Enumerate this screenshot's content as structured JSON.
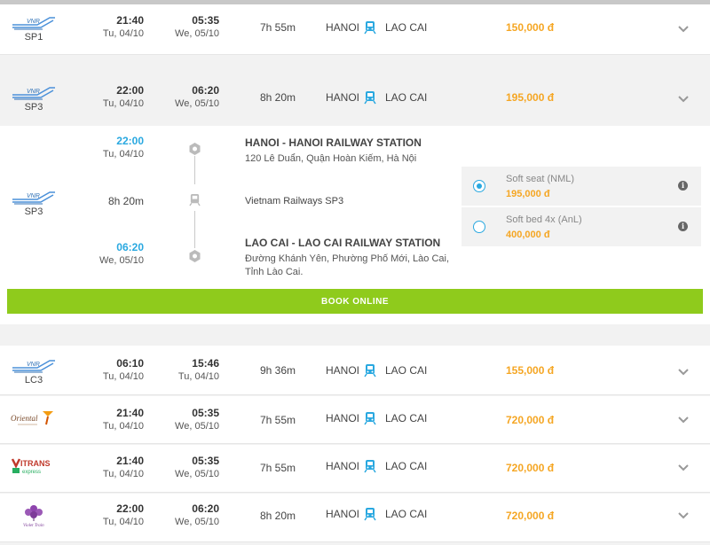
{
  "colors": {
    "accent_blue": "#29a8e0",
    "price_orange": "#f5a623",
    "book_green": "#8fcb1c"
  },
  "rows_top": [
    {
      "logo": "vnr-logo",
      "code": "SP1",
      "dep_time": "21:40",
      "dep_date": "Tu, 04/10",
      "arr_time": "05:35",
      "arr_date": "We, 05/10",
      "duration": "7h 55m",
      "from": "HANOI",
      "to": "LAO CAI",
      "price": "150,000 đ"
    },
    {
      "logo": "vnr-logo",
      "code": "SP3",
      "dep_time": "22:00",
      "dep_date": "Tu, 04/10",
      "arr_time": "06:20",
      "arr_date": "We, 05/10",
      "duration": "8h 20m",
      "from": "HANOI",
      "to": "LAO CAI",
      "price": "195,000 đ"
    }
  ],
  "detail": {
    "code": "SP3",
    "dep_time": "22:00",
    "dep_date": "Tu, 04/10",
    "arr_time": "06:20",
    "arr_date": "We, 05/10",
    "duration": "8h 20m",
    "from_station": "HANOI - HANOI RAILWAY STATION",
    "from_address": "120 Lê Duẩn, Quận Hoàn Kiếm, Hà Nội",
    "operator": "Vietnam Railways SP3",
    "to_station": "LAO CAI - LAO CAI RAILWAY STATION",
    "to_address_1": "Đường Khánh Yên, Phường Phố Mới, Lào Cai,",
    "to_address_2": "Tỉnh Lào Cai.",
    "fares": [
      {
        "name": "Soft seat (NML)",
        "price": "195,000 đ",
        "selected": true
      },
      {
        "name": "Soft bed 4x (AnL)",
        "price": "400,000 đ",
        "selected": false
      }
    ],
    "book_label": "BOOK ONLINE"
  },
  "rows_bottom": [
    {
      "logo": "vnr-logo",
      "code": "LC3",
      "dep_time": "06:10",
      "dep_date": "Tu, 04/10",
      "arr_time": "15:46",
      "arr_date": "Tu, 04/10",
      "duration": "9h 36m",
      "from": "HANOI",
      "to": "LAO CAI",
      "price": "155,000 đ"
    },
    {
      "logo": "oriental-logo",
      "code": "",
      "dep_time": "21:40",
      "dep_date": "Tu, 04/10",
      "arr_time": "05:35",
      "arr_date": "We, 05/10",
      "duration": "7h 55m",
      "from": "HANOI",
      "to": "LAO CAI",
      "price": "720,000 đ"
    },
    {
      "logo": "vitrans-logo",
      "code": "",
      "dep_time": "21:40",
      "dep_date": "Tu, 04/10",
      "arr_time": "05:35",
      "arr_date": "We, 05/10",
      "duration": "7h 55m",
      "from": "HANOI",
      "to": "LAO CAI",
      "price": "720,000 đ"
    },
    {
      "logo": "violet-logo",
      "code": "",
      "dep_time": "22:00",
      "dep_date": "Tu, 04/10",
      "arr_time": "06:20",
      "arr_date": "We, 05/10",
      "duration": "8h 20m",
      "from": "HANOI",
      "to": "LAO CAI",
      "price": "720,000 đ"
    }
  ]
}
